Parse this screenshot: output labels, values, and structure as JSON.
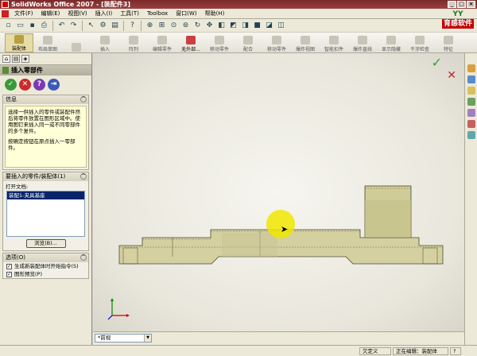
{
  "window": {
    "title": "SolidWorks Office 2007 - [装配件3]",
    "controls": [
      "_",
      "□",
      "×"
    ]
  },
  "menu": {
    "items": [
      "文件(F)",
      "编辑(E)",
      "视图(V)",
      "插入(I)",
      "工具(T)",
      "Toolbox",
      "窗口(W)",
      "帮助(H)"
    ]
  },
  "brand": {
    "top": "YY",
    "box": "育感软件"
  },
  "command_manager": {
    "buttons": [
      {
        "label": "装配体",
        "active": true
      },
      {
        "label": "布局草图",
        "active": false
      },
      {
        "label": "",
        "active": false
      },
      {
        "label": "插入",
        "active": false
      },
      {
        "label": "阵列",
        "active": false
      },
      {
        "label": "编辑零件",
        "active": false
      },
      {
        "label": "无外部...",
        "active": false
      },
      {
        "label": "移动零件",
        "active": false
      },
      {
        "label": "配合",
        "active": false
      },
      {
        "label": "移动零件",
        "active": false
      },
      {
        "label": "爆炸视图",
        "active": false
      },
      {
        "label": "智能扣件",
        "active": false
      },
      {
        "label": "爆炸直线",
        "active": false
      },
      {
        "label": "显示隐藏",
        "active": false
      },
      {
        "label": "干涉检查",
        "active": false
      },
      {
        "label": "特征",
        "active": false
      }
    ]
  },
  "property_manager": {
    "title": "插入零部件",
    "info_group_title": "信息",
    "info_text_1": "选择一供插入的零件或装配件然后将零件放置在图形区域中。使用图钉来插入同一或不同零部件的多个复件。",
    "info_text_2": "按确定按钮在原点插入一零部件。",
    "parts_group_title": "要插入的零件/装配体(1)",
    "open_docs_label": "打开文档:",
    "open_doc_item": "装配1-夹具基座",
    "browse_label": "浏览(B)...",
    "options_group_title": "选项(O)",
    "option_1": "生成新装配体时开始指令(S)",
    "option_2": "图形预览(P)"
  },
  "viewport": {
    "view_select": "*前视"
  },
  "status": {
    "cell1": "欠定义",
    "cell2": "正在编辑：装配体",
    "cell3": "?"
  }
}
